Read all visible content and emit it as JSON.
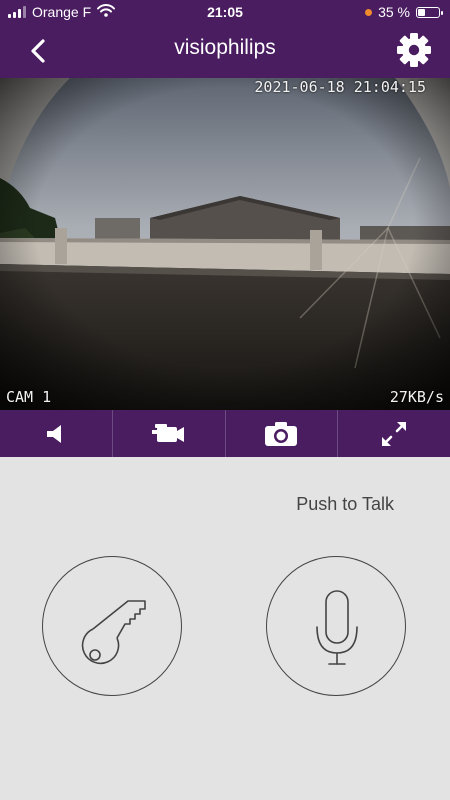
{
  "status_bar": {
    "carrier": "Orange F",
    "time": "21:05",
    "battery_percent": "35 %",
    "battery_level": 0.35
  },
  "nav": {
    "title": "visiophilips",
    "back_icon": "chevron-left-icon",
    "settings_icon": "gear-icon"
  },
  "camera": {
    "timestamp": "2021-06-18 21:04:15",
    "camera_label": "CAM 1",
    "bitrate": "27KB/s"
  },
  "controls": [
    {
      "name": "speaker",
      "icon": "speaker-icon"
    },
    {
      "name": "record",
      "icon": "video-camera-icon"
    },
    {
      "name": "snapshot",
      "icon": "camera-icon"
    },
    {
      "name": "fullscreen",
      "icon": "expand-icon"
    }
  ],
  "talk": {
    "push_to_talk_label": "Push to Talk"
  },
  "actions": {
    "unlock_icon": "key-icon",
    "mic_icon": "microphone-icon"
  },
  "colors": {
    "brand_purple": "#4a1c60",
    "background": "#e3e3e3",
    "status_dot": "#f08a2c"
  }
}
